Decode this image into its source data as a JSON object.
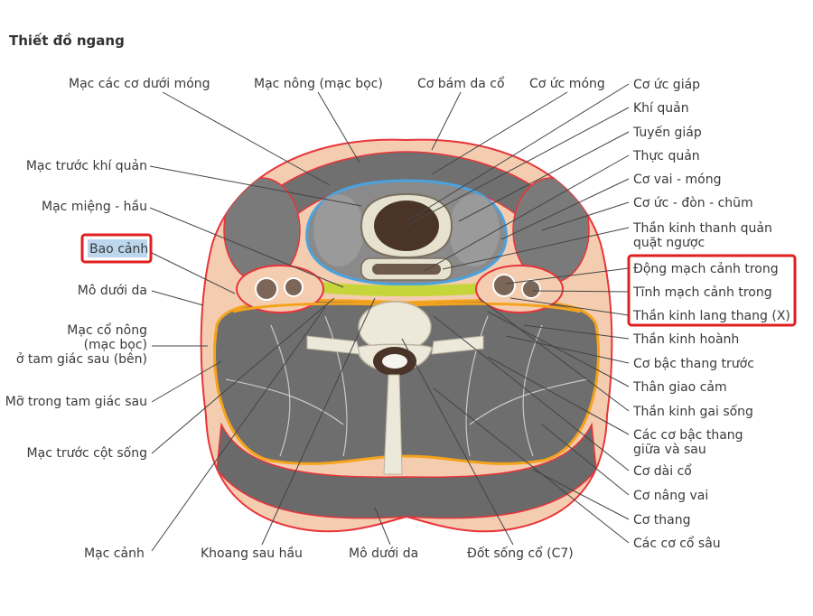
{
  "title": "Thiết đồ ngang",
  "labels_top": [
    "Mạc các cơ dưới móng",
    "Mạc nông (mạc bọc)",
    "Cơ bám da cổ",
    "Cơ ức móng"
  ],
  "labels_left": [
    "Mạc trước khí quản",
    "Mạc miệng - hầu",
    "Bao cảnh",
    "Mô dưới da",
    "Mạc cổ nông",
    "(mạc bọc)",
    "ở tam giác sau (bên)",
    "Mỡ trong tam giác sau",
    "Mạc trước cột sống"
  ],
  "labels_right": [
    "Cơ ức giáp",
    "Khí quản",
    "Tuyến giáp",
    "Thực quản",
    "Cơ vai - móng",
    "Cơ ức - đòn - chũm",
    "Thần kinh thanh quản",
    "quặt ngược",
    "Động mạch cảnh trong",
    "Tĩnh mạch cảnh trong",
    "Thần kinh lang thang (X)",
    "Thần kinh hoành",
    "Cơ bậc thang trước",
    "Thân giao cảm",
    "Thần kinh gai sống",
    "Các cơ bậc thang",
    "giữa và sau",
    "Cơ dài cổ",
    "Cơ nâng vai",
    "Cơ thang",
    "Các cơ cổ sâu"
  ],
  "labels_bottom": [
    "Mạc cảnh",
    "Khoang sau hầu",
    "Mô dưới da",
    "Đốt sống cổ (C7)"
  ],
  "colors": {
    "highlight_box": "#e02020",
    "highlight_fill": "#bcd6ee",
    "skin": "#f4cdb0",
    "muscle": "#6e6e6e",
    "fascia_red": "#e8343a",
    "fascia_blue": "#4aa3e0",
    "fascia_orange": "#f5a31c",
    "fascia_green": "#c6d63a"
  }
}
